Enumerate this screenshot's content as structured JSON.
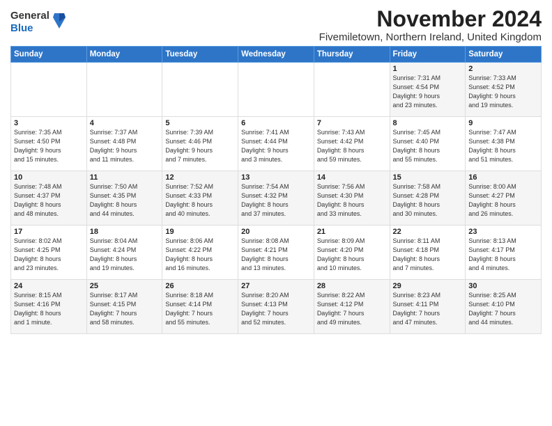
{
  "header": {
    "logo": {
      "general": "General",
      "blue": "Blue"
    },
    "title": "November 2024",
    "subtitle": "Fivemiletown, Northern Ireland, United Kingdom"
  },
  "weekdays": [
    "Sunday",
    "Monday",
    "Tuesday",
    "Wednesday",
    "Thursday",
    "Friday",
    "Saturday"
  ],
  "weeks": [
    [
      {
        "day": "",
        "info": ""
      },
      {
        "day": "",
        "info": ""
      },
      {
        "day": "",
        "info": ""
      },
      {
        "day": "",
        "info": ""
      },
      {
        "day": "",
        "info": ""
      },
      {
        "day": "1",
        "info": "Sunrise: 7:31 AM\nSunset: 4:54 PM\nDaylight: 9 hours\nand 23 minutes."
      },
      {
        "day": "2",
        "info": "Sunrise: 7:33 AM\nSunset: 4:52 PM\nDaylight: 9 hours\nand 19 minutes."
      }
    ],
    [
      {
        "day": "3",
        "info": "Sunrise: 7:35 AM\nSunset: 4:50 PM\nDaylight: 9 hours\nand 15 minutes."
      },
      {
        "day": "4",
        "info": "Sunrise: 7:37 AM\nSunset: 4:48 PM\nDaylight: 9 hours\nand 11 minutes."
      },
      {
        "day": "5",
        "info": "Sunrise: 7:39 AM\nSunset: 4:46 PM\nDaylight: 9 hours\nand 7 minutes."
      },
      {
        "day": "6",
        "info": "Sunrise: 7:41 AM\nSunset: 4:44 PM\nDaylight: 9 hours\nand 3 minutes."
      },
      {
        "day": "7",
        "info": "Sunrise: 7:43 AM\nSunset: 4:42 PM\nDaylight: 8 hours\nand 59 minutes."
      },
      {
        "day": "8",
        "info": "Sunrise: 7:45 AM\nSunset: 4:40 PM\nDaylight: 8 hours\nand 55 minutes."
      },
      {
        "day": "9",
        "info": "Sunrise: 7:47 AM\nSunset: 4:38 PM\nDaylight: 8 hours\nand 51 minutes."
      }
    ],
    [
      {
        "day": "10",
        "info": "Sunrise: 7:48 AM\nSunset: 4:37 PM\nDaylight: 8 hours\nand 48 minutes."
      },
      {
        "day": "11",
        "info": "Sunrise: 7:50 AM\nSunset: 4:35 PM\nDaylight: 8 hours\nand 44 minutes."
      },
      {
        "day": "12",
        "info": "Sunrise: 7:52 AM\nSunset: 4:33 PM\nDaylight: 8 hours\nand 40 minutes."
      },
      {
        "day": "13",
        "info": "Sunrise: 7:54 AM\nSunset: 4:32 PM\nDaylight: 8 hours\nand 37 minutes."
      },
      {
        "day": "14",
        "info": "Sunrise: 7:56 AM\nSunset: 4:30 PM\nDaylight: 8 hours\nand 33 minutes."
      },
      {
        "day": "15",
        "info": "Sunrise: 7:58 AM\nSunset: 4:28 PM\nDaylight: 8 hours\nand 30 minutes."
      },
      {
        "day": "16",
        "info": "Sunrise: 8:00 AM\nSunset: 4:27 PM\nDaylight: 8 hours\nand 26 minutes."
      }
    ],
    [
      {
        "day": "17",
        "info": "Sunrise: 8:02 AM\nSunset: 4:25 PM\nDaylight: 8 hours\nand 23 minutes."
      },
      {
        "day": "18",
        "info": "Sunrise: 8:04 AM\nSunset: 4:24 PM\nDaylight: 8 hours\nand 19 minutes."
      },
      {
        "day": "19",
        "info": "Sunrise: 8:06 AM\nSunset: 4:22 PM\nDaylight: 8 hours\nand 16 minutes."
      },
      {
        "day": "20",
        "info": "Sunrise: 8:08 AM\nSunset: 4:21 PM\nDaylight: 8 hours\nand 13 minutes."
      },
      {
        "day": "21",
        "info": "Sunrise: 8:09 AM\nSunset: 4:20 PM\nDaylight: 8 hours\nand 10 minutes."
      },
      {
        "day": "22",
        "info": "Sunrise: 8:11 AM\nSunset: 4:18 PM\nDaylight: 8 hours\nand 7 minutes."
      },
      {
        "day": "23",
        "info": "Sunrise: 8:13 AM\nSunset: 4:17 PM\nDaylight: 8 hours\nand 4 minutes."
      }
    ],
    [
      {
        "day": "24",
        "info": "Sunrise: 8:15 AM\nSunset: 4:16 PM\nDaylight: 8 hours\nand 1 minute."
      },
      {
        "day": "25",
        "info": "Sunrise: 8:17 AM\nSunset: 4:15 PM\nDaylight: 7 hours\nand 58 minutes."
      },
      {
        "day": "26",
        "info": "Sunrise: 8:18 AM\nSunset: 4:14 PM\nDaylight: 7 hours\nand 55 minutes."
      },
      {
        "day": "27",
        "info": "Sunrise: 8:20 AM\nSunset: 4:13 PM\nDaylight: 7 hours\nand 52 minutes."
      },
      {
        "day": "28",
        "info": "Sunrise: 8:22 AM\nSunset: 4:12 PM\nDaylight: 7 hours\nand 49 minutes."
      },
      {
        "day": "29",
        "info": "Sunrise: 8:23 AM\nSunset: 4:11 PM\nDaylight: 7 hours\nand 47 minutes."
      },
      {
        "day": "30",
        "info": "Sunrise: 8:25 AM\nSunset: 4:10 PM\nDaylight: 7 hours\nand 44 minutes."
      }
    ]
  ]
}
